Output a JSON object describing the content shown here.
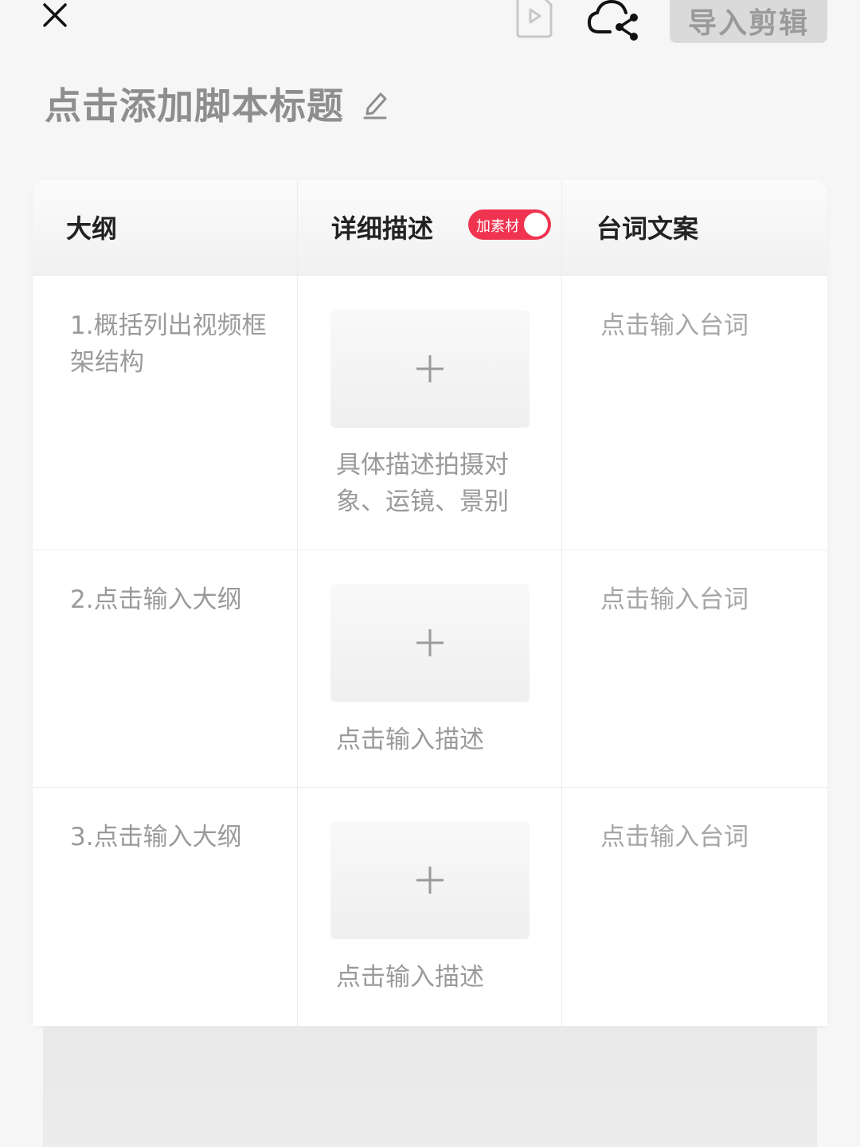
{
  "header": {
    "import_label": "导入剪辑"
  },
  "script": {
    "title": "点击添加脚本标题"
  },
  "table": {
    "columns": {
      "outline": "大纲",
      "description": "详细描述",
      "lines": "台词文案"
    },
    "material_toggle": {
      "label": "加素材",
      "on": true
    },
    "rows": [
      {
        "outline": "1.概括列出视频框架结构",
        "description": "具体描述拍摄对象、运镜、景别",
        "lines": "点击输入台词"
      },
      {
        "outline": "2.点击输入大纲",
        "description": "点击输入描述",
        "lines": "点击输入台词"
      },
      {
        "outline": "3.点击输入大纲",
        "description": "点击输入描述",
        "lines": "点击输入台词"
      }
    ]
  },
  "icons": {
    "close": "close-icon",
    "preview": "play-file-icon",
    "share": "cloud-share-icon",
    "edit": "pencil-icon",
    "add_media": "plus-icon"
  },
  "colors": {
    "accent": "#f0344f",
    "background": "#f6f6f6"
  }
}
